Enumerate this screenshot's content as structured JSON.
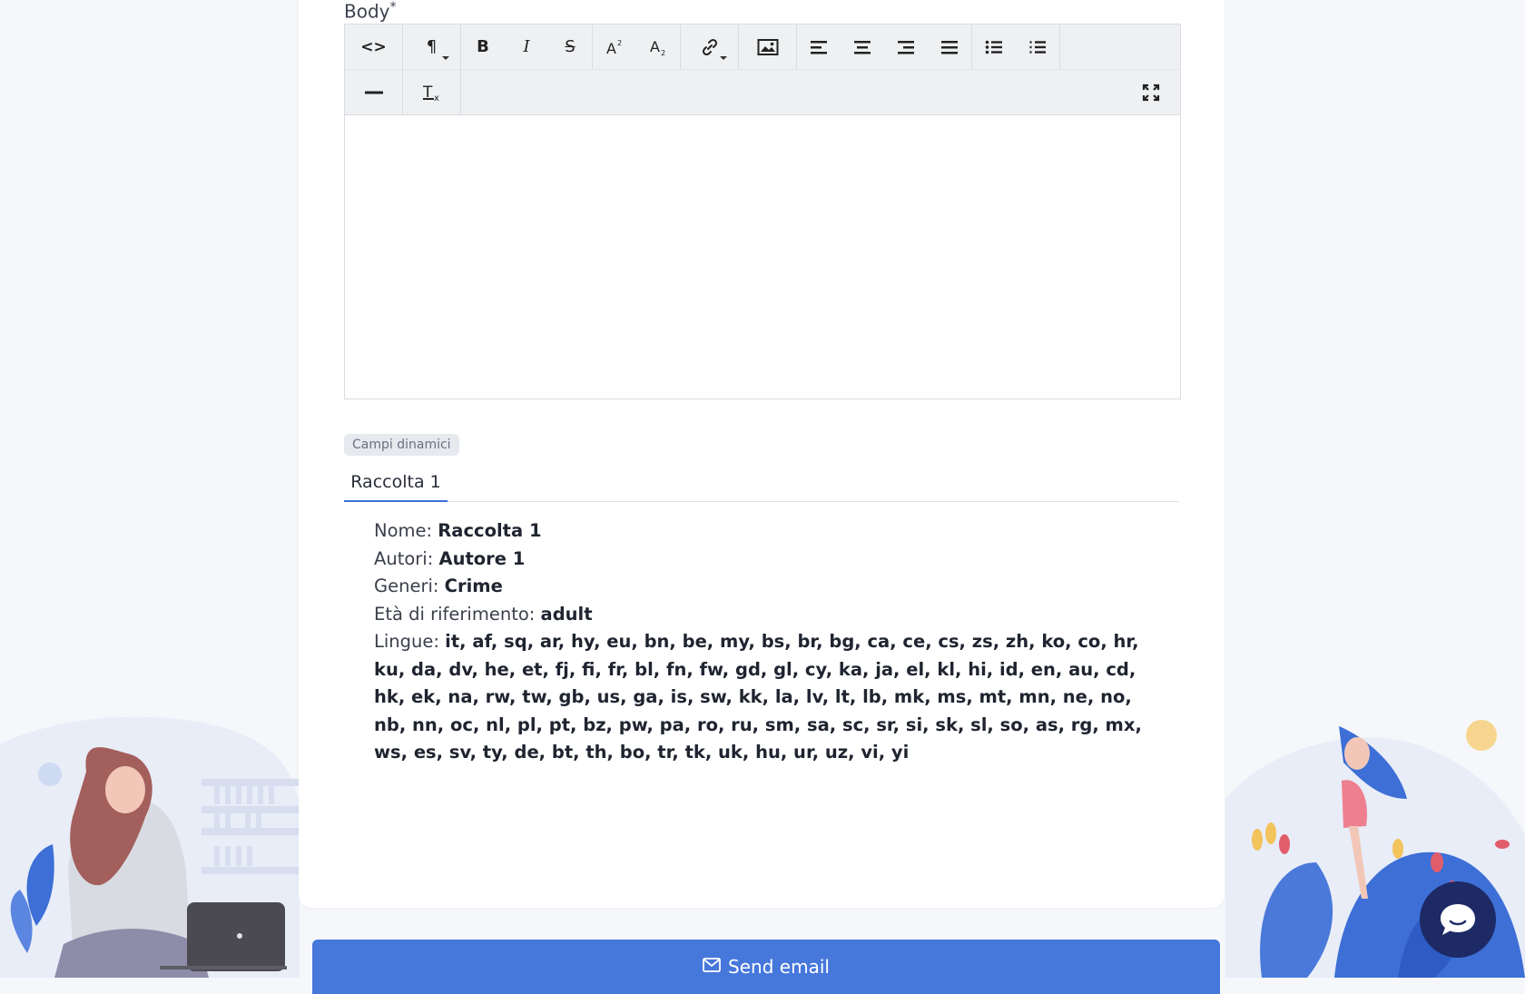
{
  "editor": {
    "label": "Body",
    "required_mark": "*",
    "toolbar": {
      "source_label": "<>",
      "paragraph_label": "¶",
      "bold_label": "B",
      "italic_label": "I",
      "strike_label": "S",
      "hr_label": "—"
    }
  },
  "dynamic_fields": {
    "badge": "Campi dinamici",
    "tabs": [
      {
        "label": "Raccolta 1"
      }
    ]
  },
  "details": {
    "name_label": "Nome:",
    "name_value": "Raccolta 1",
    "authors_label": "Autori:",
    "authors_value": "Autore 1",
    "genres_label": "Generi:",
    "genres_value": "Crime",
    "age_label": "Età di riferimento:",
    "age_value": "adult",
    "languages_label": "Lingue:",
    "languages_value": "it, af, sq, ar, hy, eu, bn, be, my, bs, br, bg, ca, ce, cs, zs, zh, ko, co, hr, ku, da, dv, he, et, fj, fi, fr, bl, fn, fw, gd, gl, cy, ka, ja, el, kl, hi, id, en, au, cd, hk, ek, na, rw, tw, gb, us, ga, is, sw, kk, la, lv, lt, lb, mk, ms, mt, mn, ne, no, nb, nn, oc, nl, pl, pt, bz, pw, pa, ro, ru, sm, sa, sc, sr, si, sk, sl, so, as, rg, mx, ws, es, sv, ty, de, bt, th, bo, tr, tk, uk, hu, ur, uz, vi, yi"
  },
  "actions": {
    "send_label": "Send email"
  },
  "colors": {
    "accent": "#4677db",
    "chat": "#1e2a66",
    "tab_underline": "#3b6fd8"
  }
}
